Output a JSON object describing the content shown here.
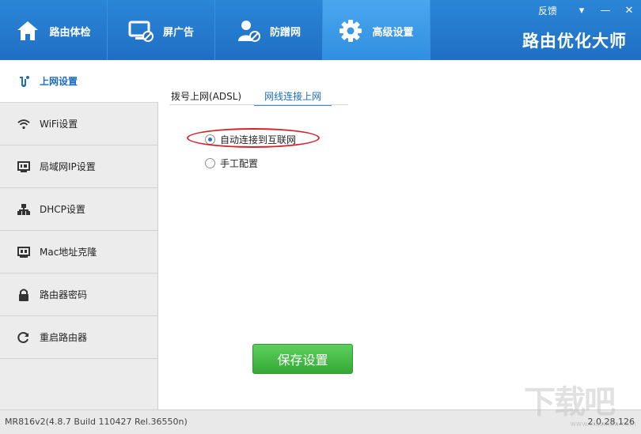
{
  "app": {
    "brand": "路由优化大师",
    "feedback": "反馈",
    "window_controls": {
      "menu": "▾",
      "minimize": "—",
      "close": "✕"
    }
  },
  "nav": {
    "items": [
      {
        "label": "路由体检",
        "icon": "home-icon"
      },
      {
        "label": "屏广告",
        "icon": "monitor-block-icon"
      },
      {
        "label": "防蹭网",
        "icon": "user-block-icon"
      },
      {
        "label": "高级设置",
        "icon": "gear-icon"
      }
    ],
    "active_index": 3
  },
  "sidebar": {
    "items": [
      {
        "label": "上网设置",
        "icon": "internet-icon"
      },
      {
        "label": "WiFi设置",
        "icon": "wifi-icon"
      },
      {
        "label": "局域网IP设置",
        "icon": "ip-icon"
      },
      {
        "label": "DHCP设置",
        "icon": "network-tree-icon"
      },
      {
        "label": "Mac地址克隆",
        "icon": "network-card-icon"
      },
      {
        "label": "路由器密码",
        "icon": "lock-icon"
      },
      {
        "label": "重启路由器",
        "icon": "refresh-icon"
      }
    ],
    "active_index": 0
  },
  "content": {
    "tabs": [
      {
        "label": "拨号上网(ADSL)"
      },
      {
        "label": "网线连接上网"
      }
    ],
    "active_tab": 1,
    "options": [
      {
        "label": "自动连接到互联网",
        "selected": true
      },
      {
        "label": "手工配置",
        "selected": false
      }
    ],
    "save_label": "保存设置"
  },
  "footer": {
    "version_left": "MR816v2(4.8.7 Build 110427 Rel.36550n)",
    "version_right": "2.0.28.126"
  },
  "watermark": {
    "text": "下载吧",
    "site": "www.xiazaiba.com"
  },
  "colors": {
    "header": "#2178c9",
    "nav_active": "#3d9ae7",
    "accent": "#1a6cc4",
    "save_button": "#45bb45",
    "highlight_oval": "#d5232b"
  }
}
